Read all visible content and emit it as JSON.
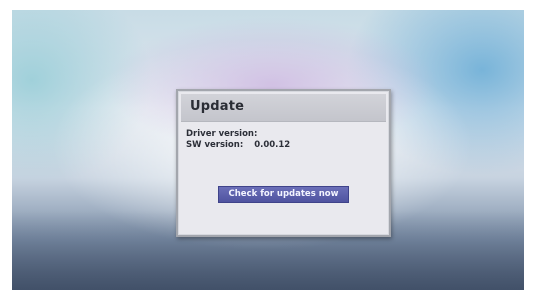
{
  "dialog": {
    "title": "Update",
    "driver_version_label": "Driver version:",
    "driver_version_value": "",
    "sw_version_label": "SW version:",
    "sw_version_value": "0.00.12",
    "check_button_label": "Check for updates now"
  },
  "colors": {
    "button_bg": "#5a5eaa",
    "dialog_bg": "#e9e9ee",
    "header_bg": "#c9cad0"
  }
}
